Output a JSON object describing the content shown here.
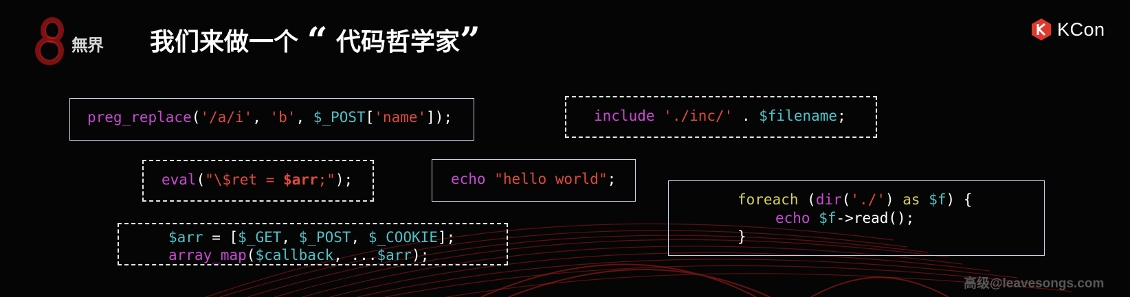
{
  "logo": {
    "text": "無界"
  },
  "title": {
    "prefix": "我们来做一个",
    "open_quote": "“",
    "phrase": "代码哲学家",
    "close_quote": "”"
  },
  "brand": {
    "name": "KCon"
  },
  "snippets": {
    "preg": {
      "fn": "preg_replace",
      "p1": "(",
      "s1": "'/a/i'",
      "c1": ", ",
      "s2": "'b'",
      "c2": ", ",
      "v1": "$_POST",
      "b1": "[",
      "s3": "'name'",
      "end": "]);"
    },
    "include": {
      "kw": "include",
      "sp": " ",
      "s1": "'./inc/'",
      "op": " . ",
      "v1": "$filename",
      "end": ";"
    },
    "eval": {
      "fn": "eval",
      "p1": "(",
      "s1": "\"\\$ret = ",
      "v1": "$arr",
      "s2": ";\"",
      "end": ");"
    },
    "echo": {
      "kw": "echo",
      "sp": " ",
      "s1": "\"hello world\"",
      "end": ";"
    },
    "foreach": {
      "kw1": "foreach",
      "p1": " (",
      "fn": "dir",
      "p2": "(",
      "s1": "'./'",
      "p3": ")",
      "kw2": " as ",
      "v1": "$f",
      "p4": ") {",
      "kw3": "echo",
      "sp": " ",
      "v2": "$f",
      "call": "->read();",
      "close": "}"
    },
    "arraymap": {
      "v1": "$arr",
      "eq": " = [",
      "v2": "$_GET",
      "c1": ", ",
      "v3": "$_POST",
      "c2": ", ",
      "v4": "$_COOKIE",
      "end1": "];",
      "fn": "array_map",
      "p1": "(",
      "v5": "$callback",
      "c3": ", ...",
      "v6": "$arr",
      "end2": ");"
    }
  },
  "watermark": "高级@leavesongs.com"
}
